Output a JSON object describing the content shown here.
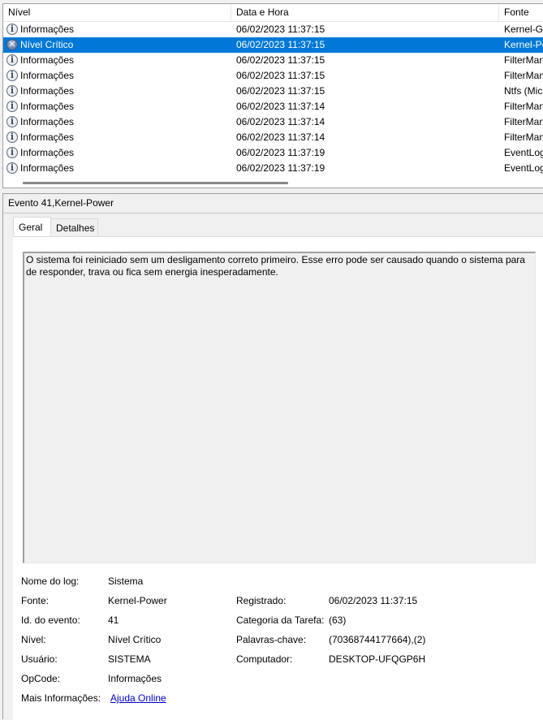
{
  "list": {
    "columns": [
      "Nível",
      "Data e Hora",
      "Fonte"
    ],
    "rows": [
      {
        "level": "Informações",
        "icon": "info-icon",
        "datetime": "06/02/2023 11:37:15",
        "source": "Kernel-General"
      },
      {
        "level": "Nível Crítico",
        "icon": "critical-error-icon",
        "datetime": "06/02/2023 11:37:15",
        "source": "Kernel-Power"
      },
      {
        "level": "Informações",
        "icon": "info-icon",
        "datetime": "06/02/2023 11:37:15",
        "source": "FilterManager"
      },
      {
        "level": "Informações",
        "icon": "info-icon",
        "datetime": "06/02/2023 11:37:15",
        "source": "FilterManager"
      },
      {
        "level": "Informações",
        "icon": "info-icon",
        "datetime": "06/02/2023 11:37:15",
        "source": "Ntfs (Microsoft-Windows-Ntfs)"
      },
      {
        "level": "Informações",
        "icon": "info-icon",
        "datetime": "06/02/2023 11:37:14",
        "source": "FilterManager"
      },
      {
        "level": "Informações",
        "icon": "info-icon",
        "datetime": "06/02/2023 11:37:14",
        "source": "FilterManager"
      },
      {
        "level": "Informações",
        "icon": "info-icon",
        "datetime": "06/02/2023 11:37:14",
        "source": "FilterManager"
      },
      {
        "level": "Informações",
        "icon": "info-icon",
        "datetime": "06/02/2023 11:37:19",
        "source": "EventLog"
      },
      {
        "level": "Informações",
        "icon": "info-icon",
        "datetime": "06/02/2023 11:37:19",
        "source": "EventLog"
      }
    ],
    "selected_index": 1,
    "selection_color": "#0078d7"
  },
  "detail": {
    "title": "Evento 41,Kernel-Power",
    "tabs": [
      "Geral",
      "Detalhes"
    ],
    "active_tab": "Geral",
    "description": "O sistema foi reiniciado sem um desligamento correto primeiro. Esse erro pode ser causado quando o sistema para de responder, trava ou fica sem energia inesperadamente.",
    "properties": {
      "log_name_label": "Nome do log:",
      "log_name": "Sistema",
      "source_label": "Fonte:",
      "source": "Kernel-Power",
      "event_id_label": "Id. do evento:",
      "event_id": "41",
      "level_label": "Nível:",
      "level": "Nível Crítico",
      "user_label": "Usuário:",
      "user": "SISTEMA",
      "opcode_label": "OpCode:",
      "opcode": "Informações",
      "more_info_label": "Mais Informações:",
      "more_info_link": "Ajuda Online",
      "logged_label": "Registrado:",
      "logged": "06/02/2023 11:37:15",
      "task_category_label": "Categoria da Tarefa:",
      "task_category": "(63)",
      "keywords_label": "Palavras-chave:",
      "keywords": "(70368744177664),(2)",
      "computer_label": "Computador:",
      "computer": "DESKTOP-UFQGP6H"
    }
  }
}
